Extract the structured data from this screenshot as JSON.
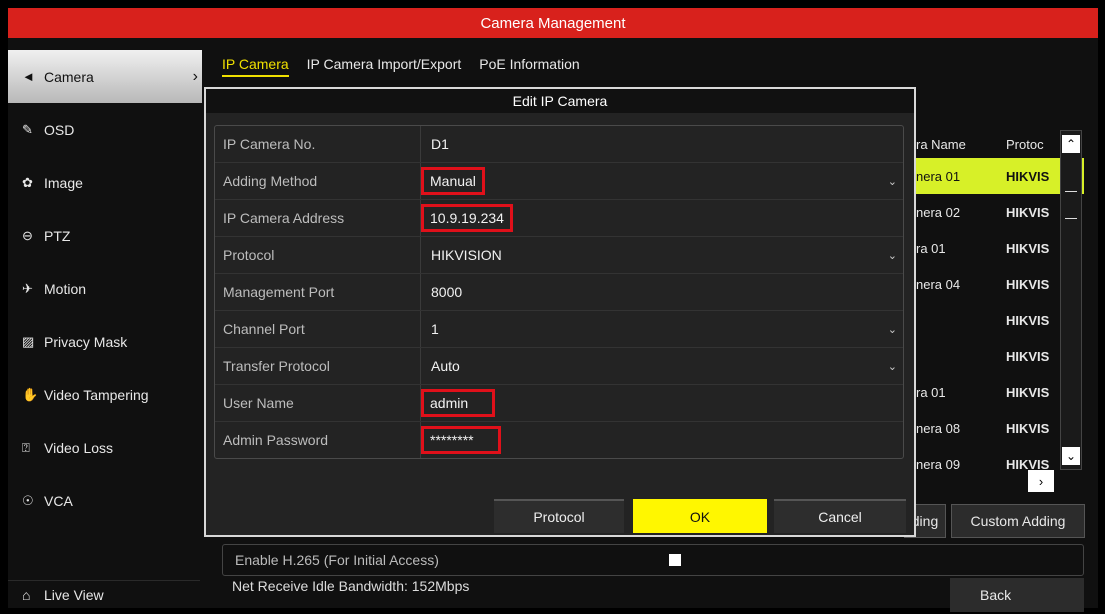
{
  "window": {
    "title": "Camera Management"
  },
  "sidebar": {
    "items": [
      {
        "label": "Camera",
        "icon": "camera-icon",
        "glyph": "◄",
        "active": true
      },
      {
        "label": "OSD",
        "icon": "osd-icon",
        "glyph": "✎"
      },
      {
        "label": "Image",
        "icon": "image-icon",
        "glyph": "✿"
      },
      {
        "label": "PTZ",
        "icon": "ptz-icon",
        "glyph": "⊖"
      },
      {
        "label": "Motion",
        "icon": "motion-icon",
        "glyph": "✈"
      },
      {
        "label": "Privacy Mask",
        "icon": "privacy-mask-icon",
        "glyph": "▨"
      },
      {
        "label": "Video Tampering",
        "icon": "video-tampering-icon",
        "glyph": "✋"
      },
      {
        "label": "Video Loss",
        "icon": "video-loss-icon",
        "glyph": "⍰"
      },
      {
        "label": "VCA",
        "icon": "vca-icon",
        "glyph": "☉"
      }
    ],
    "live_view": {
      "label": "Live View",
      "icon": "home-icon",
      "glyph": "⌂"
    }
  },
  "tabs": [
    {
      "label": "IP Camera",
      "active": true
    },
    {
      "label": "IP Camera Import/Export"
    },
    {
      "label": "PoE Information"
    }
  ],
  "camera_table": {
    "headers": [
      "ra Name",
      "Protoc"
    ],
    "rows": [
      [
        "nera 01",
        "HIKVIS"
      ],
      [
        "nera 02",
        "HIKVIS"
      ],
      [
        "ra 01",
        "HIKVIS"
      ],
      [
        "nera 04",
        "HIKVIS"
      ],
      [
        "",
        "HIKVIS"
      ],
      [
        "",
        "HIKVIS"
      ],
      [
        "ra 01",
        "HIKVIS"
      ],
      [
        "nera 08",
        "HIKVIS"
      ],
      [
        "nera 09",
        "HIKVIS"
      ]
    ],
    "selected_row": 0
  },
  "buttons": {
    "adding": "ding",
    "custom_adding": "Custom Adding",
    "back": "Back",
    "page_next": "›"
  },
  "enable_h265": {
    "label": "Enable H.265 (For Initial Access)",
    "checked": false
  },
  "bandwidth": "Net Receive Idle Bandwidth: 152Mbps",
  "dialog": {
    "title": "Edit IP Camera",
    "fields": [
      {
        "label": "IP Camera No.",
        "value": "D1"
      },
      {
        "label": "Adding Method",
        "value": "Manual",
        "dropdown": true,
        "highlight": true
      },
      {
        "label": "IP Camera Address",
        "value": "10.9.19.234",
        "highlight": true
      },
      {
        "label": "Protocol",
        "value": "HIKVISION",
        "dropdown": true
      },
      {
        "label": "Management Port",
        "value": "8000"
      },
      {
        "label": "Channel Port",
        "value": "1",
        "dropdown": true
      },
      {
        "label": "Transfer Protocol",
        "value": "Auto",
        "dropdown": true
      },
      {
        "label": "User Name",
        "value": "admin",
        "highlight": true
      },
      {
        "label": "Admin Password",
        "value": "********",
        "highlight": true
      }
    ],
    "buttons": {
      "protocol": "Protocol",
      "ok": "OK",
      "cancel": "Cancel"
    }
  },
  "colors": {
    "title_bar": "#d8211c",
    "accent_yellow": "#fff700",
    "selected_row": "#d7f028",
    "highlight_box": "#e0101a"
  }
}
